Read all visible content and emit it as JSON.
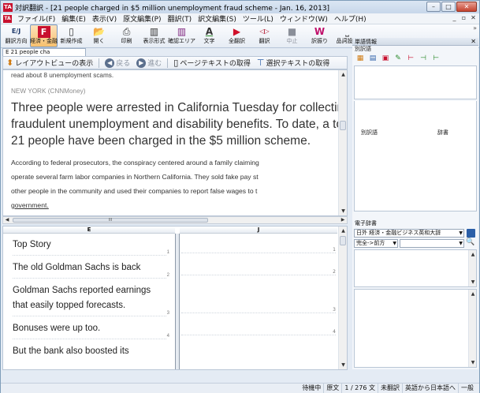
{
  "window": {
    "title": "対訳翻訳 - [21 people charged in $5 million unemployment fraud scheme - Jan. 16, 2013]",
    "app_icon_text": "TA",
    "menu_icon_text": "TA",
    "min": "–",
    "max": "□",
    "close": "✕",
    "mdi_min": "_",
    "mdi_restore": "▫",
    "mdi_close": "✕"
  },
  "menu": [
    "ファイル(F)",
    "編集(E)",
    "表示(V)",
    "原文編集(P)",
    "翻訳(T)",
    "訳文編集(S)",
    "ツール(L)",
    "ウィンドウ(W)",
    "ヘルプ(H)"
  ],
  "toolbar": [
    {
      "icon": "direction-icon",
      "glyph": "E/J",
      "label": "翻訳方向"
    },
    {
      "icon": "finance-icon",
      "glyph": "F",
      "label": "経済・金融",
      "active": true
    },
    {
      "icon": "new-document-icon",
      "glyph": "▯",
      "label": "新規作成"
    },
    {
      "icon": "open-folder-icon",
      "glyph": "📂",
      "label": "開く"
    },
    {
      "icon": "print-icon",
      "glyph": "⎙",
      "label": "印刷"
    },
    {
      "icon": "layout-icon",
      "glyph": "▥",
      "label": "表示形式"
    },
    {
      "icon": "confirm-area-icon",
      "glyph": "▥",
      "label": "確認エリア"
    },
    {
      "icon": "font-icon",
      "glyph": "A",
      "label": "文字"
    },
    {
      "icon": "translate-all-icon",
      "glyph": "▶",
      "label": "全翻訳"
    },
    {
      "icon": "translate-icon",
      "glyph": "◁▷",
      "label": "翻訳"
    },
    {
      "icon": "stop-icon",
      "glyph": "■",
      "label": "中止"
    },
    {
      "icon": "word-choice-icon",
      "glyph": "W",
      "label": "訳振り"
    },
    {
      "icon": "pos-setting-icon",
      "glyph": "⎵",
      "label": "品詞設定"
    }
  ],
  "toolbar_more": "»",
  "doc_tab": "E 21 people cha",
  "doc_bar": {
    "layout_view": "レイアウトビューの表示",
    "back": "戻る",
    "forward": "進む",
    "get_page_text": "ページテキストの取得",
    "get_selected_text": "選択テキストの取得"
  },
  "web": {
    "small_line": "read about 8 unemployment scams.",
    "dateline": "NEW YORK (CNNMoney)",
    "lead_lines": [
      "Three people were arrested in California Tuesday for collectin",
      "fraudulent unemployment and disability benefits. To date, a to",
      "21 people have been charged in the $5 million scheme."
    ],
    "para_lines": [
      "According to federal prosecutors, the conspiracy centered around a family claiming",
      "operate several farm labor companies in Northern California. They sold fake pay st",
      "other people in the community and used their companies to report false wages to t",
      "government."
    ]
  },
  "hscroll_grip": "III",
  "split": {
    "col_e": "E",
    "col_j": "J",
    "rows": [
      {
        "text": [
          "Top Story"
        ],
        "num": "1"
      },
      {
        "text": [
          "The old Goldman Sachs is back"
        ],
        "num": "2"
      },
      {
        "text": [
          "Goldman Sachs reported earnings",
          "that easily topped forecasts."
        ],
        "num": "3"
      },
      {
        "text": [
          "Bonuses were up too."
        ],
        "num": "4"
      },
      {
        "text": [
          "But the bank also boosted its"
        ],
        "num": ""
      }
    ],
    "j_nums": [
      "1",
      "2",
      "3",
      "4"
    ]
  },
  "word_info": {
    "title": "単語情報",
    "close": "✕",
    "sub": "別訳語",
    "col_alt": "別訳語",
    "col_dict": "辞書"
  },
  "edict": {
    "title": "電子辞書",
    "dict_select": "日外 経済・金融ビジネス英和大辞",
    "mode_select": "完全->前方",
    "search_icon": "🔍"
  },
  "status": [
    "待機中",
    "原文",
    "1 / 276 文",
    "未翻訳",
    "英語から日本語へ",
    "一般"
  ]
}
